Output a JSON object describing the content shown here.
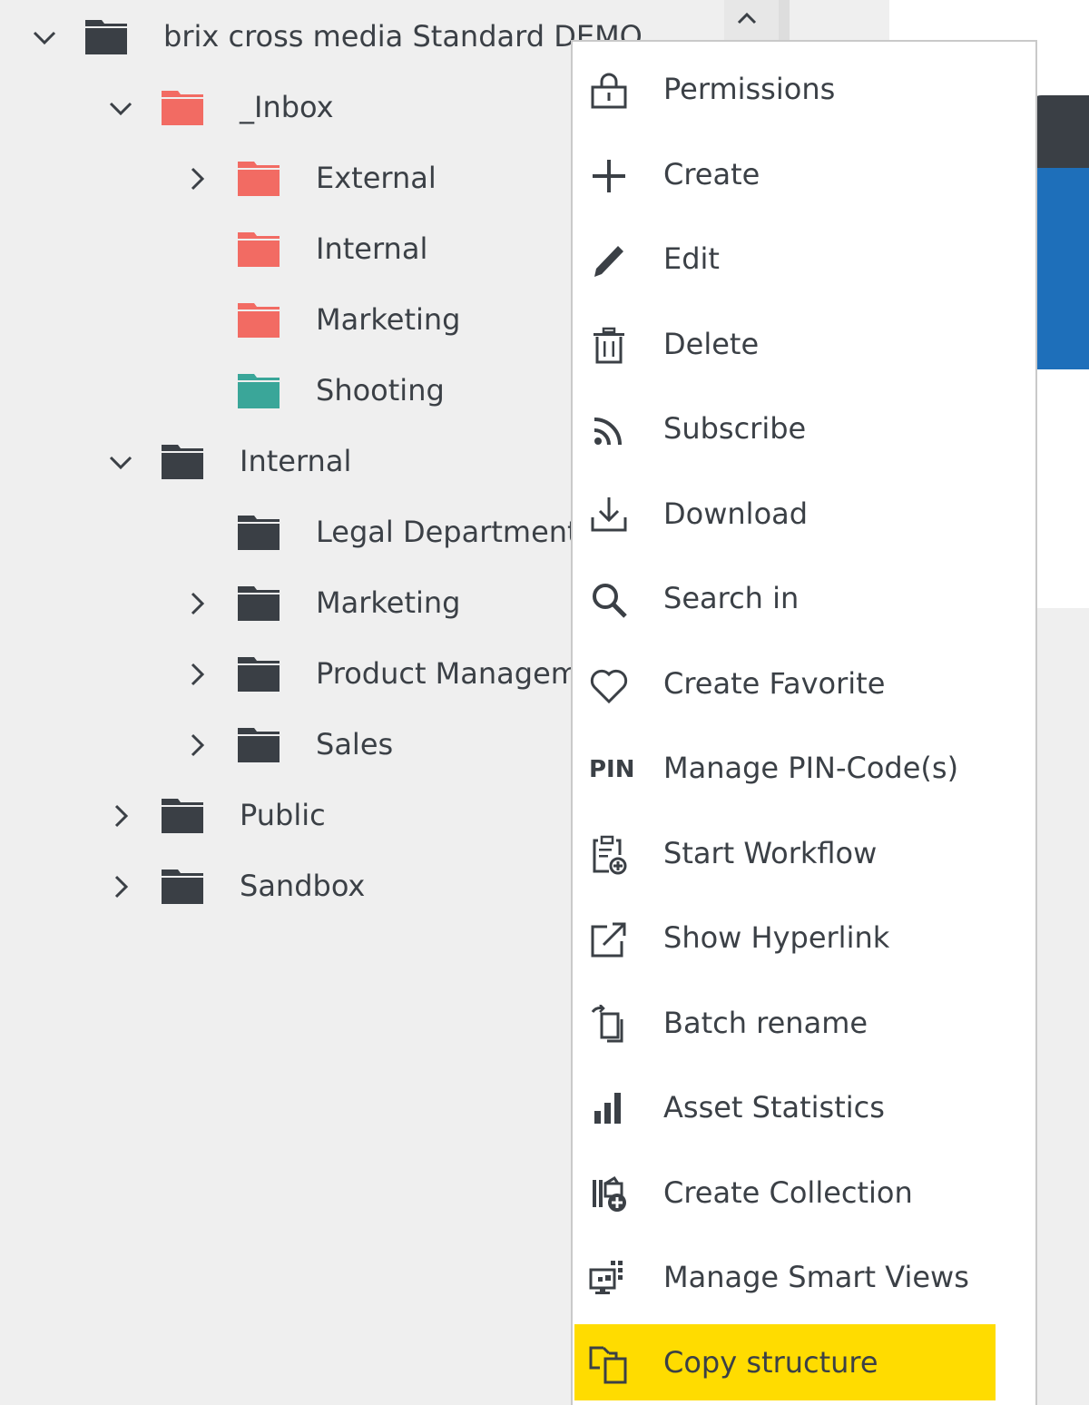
{
  "tree": {
    "root": {
      "label": "brix cross media Standard DEMO"
    },
    "items": [
      {
        "label": "_Inbox"
      },
      {
        "label": "External"
      },
      {
        "label": "Internal"
      },
      {
        "label": "Marketing"
      },
      {
        "label": "Shooting"
      },
      {
        "label": "Internal"
      },
      {
        "label": "Legal Department"
      },
      {
        "label": "Marketing"
      },
      {
        "label": "Product Management"
      },
      {
        "label": "Sales"
      },
      {
        "label": "Public"
      },
      {
        "label": "Sandbox"
      }
    ]
  },
  "colors": {
    "folder_default": "#3a3f45",
    "folder_inbox": "#f26b63",
    "folder_shooting": "#3aa699",
    "highlight": "#ffdc00",
    "accent_blue": "#1e6fba"
  },
  "menu": {
    "items": [
      {
        "label": "Permissions",
        "icon": "lock-icon"
      },
      {
        "label": "Create",
        "icon": "plus-icon"
      },
      {
        "label": "Edit",
        "icon": "pencil-icon"
      },
      {
        "label": "Delete",
        "icon": "trash-icon"
      },
      {
        "label": "Subscribe",
        "icon": "rss-icon"
      },
      {
        "label": "Download",
        "icon": "download-icon"
      },
      {
        "label": "Search in",
        "icon": "search-icon"
      },
      {
        "label": "Create Favorite",
        "icon": "heart-icon"
      },
      {
        "label": "Manage PIN-Code(s)",
        "icon": "pin-icon",
        "icon_text": "PIN"
      },
      {
        "label": "Start Workflow",
        "icon": "clipboard-plus-icon"
      },
      {
        "label": "Show Hyperlink",
        "icon": "external-link-icon"
      },
      {
        "label": "Batch rename",
        "icon": "batch-rename-icon"
      },
      {
        "label": "Asset Statistics",
        "icon": "bar-chart-icon"
      },
      {
        "label": "Create Collection",
        "icon": "collection-plus-icon"
      },
      {
        "label": "Manage Smart Views",
        "icon": "smart-views-icon"
      },
      {
        "label": "Copy structure",
        "icon": "copy-structure-icon"
      }
    ]
  }
}
